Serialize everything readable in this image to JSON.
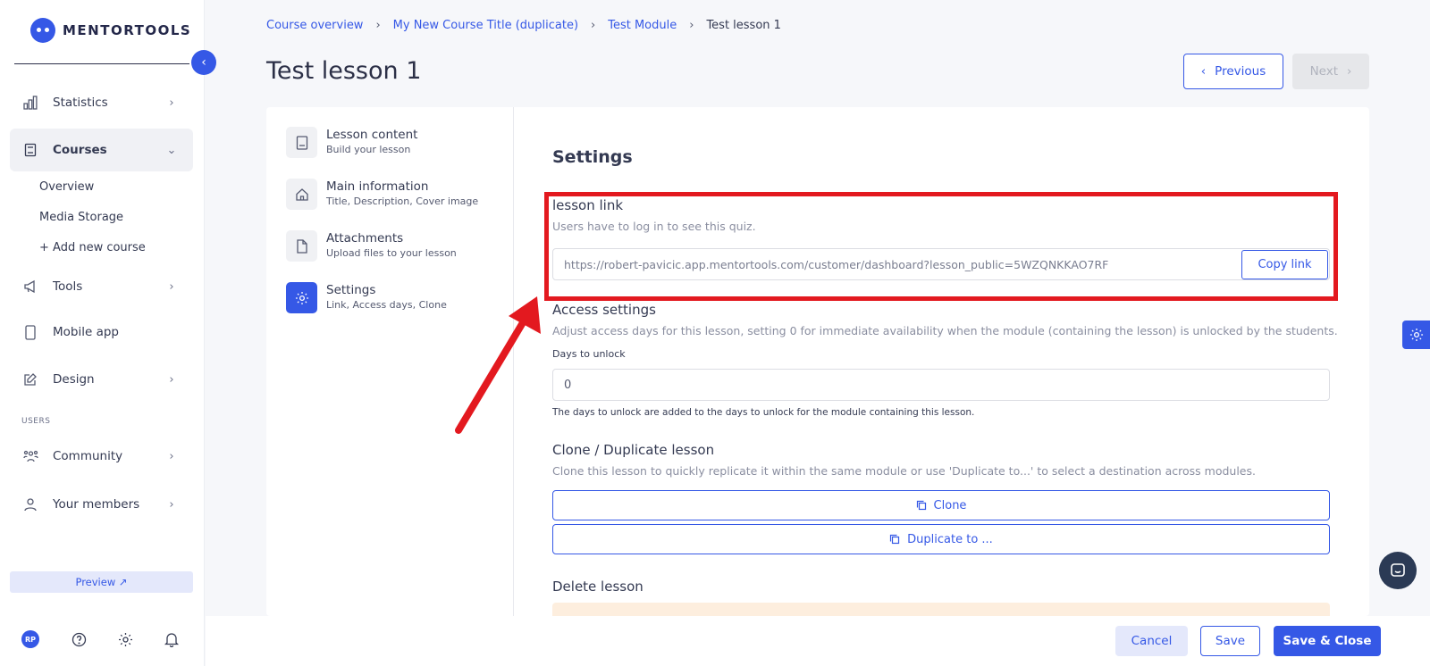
{
  "brand": {
    "name": "MENTORTOOLS"
  },
  "sidebar": {
    "items": [
      {
        "label": "Statistics"
      },
      {
        "label": "Courses"
      },
      {
        "label": "Tools"
      },
      {
        "label": "Mobile app"
      },
      {
        "label": "Design"
      },
      {
        "label": "Community"
      },
      {
        "label": "Your members"
      }
    ],
    "courses_sub": [
      "Overview",
      "Media Storage",
      "+ Add new course"
    ],
    "users_section": "USERS",
    "preview": "Preview ↗",
    "avatar_initials": "RP"
  },
  "breadcrumb": [
    "Course overview",
    "My New Course Title (duplicate)",
    "Test Module",
    "Test lesson 1"
  ],
  "header": {
    "title": "Test lesson 1",
    "previous": "Previous",
    "next": "Next"
  },
  "steps": [
    {
      "title": "Lesson content",
      "sub": "Build your lesson"
    },
    {
      "title": "Main information",
      "sub": "Title, Description, Cover image"
    },
    {
      "title": "Attachments",
      "sub": "Upload files to your lesson"
    },
    {
      "title": "Settings",
      "sub": "Link, Access days, Clone"
    }
  ],
  "settings": {
    "title": "Settings",
    "lesson_link": {
      "label": "lesson link",
      "help": "Users have to log in to see this quiz.",
      "url": "https://robert-pavicic.app.mentortools.com/customer/dashboard?lesson_public=5WZQNKKAO7RF",
      "copy": "Copy link"
    },
    "access": {
      "label": "Access settings",
      "help": "Adjust access days for this lesson, setting 0 for immediate availability when the module (containing the lesson) is unlocked by the students.",
      "days_label": "Days to unlock",
      "days_value": "0",
      "note": "The days to unlock are added to the days to unlock for the module containing this lesson."
    },
    "clone": {
      "label": "Clone / Duplicate lesson",
      "help": "Clone this lesson to quickly replicate it within the same module or use 'Duplicate to...' to select a destination across modules.",
      "clone_btn": "Clone",
      "duplicate_btn": "Duplicate to ..."
    },
    "delete": {
      "label": "Delete lesson"
    }
  },
  "footer": {
    "cancel": "Cancel",
    "save": "Save",
    "save_close": "Save & Close"
  },
  "colors": {
    "accent": "#3558e6",
    "annotation": "#e3191f"
  }
}
